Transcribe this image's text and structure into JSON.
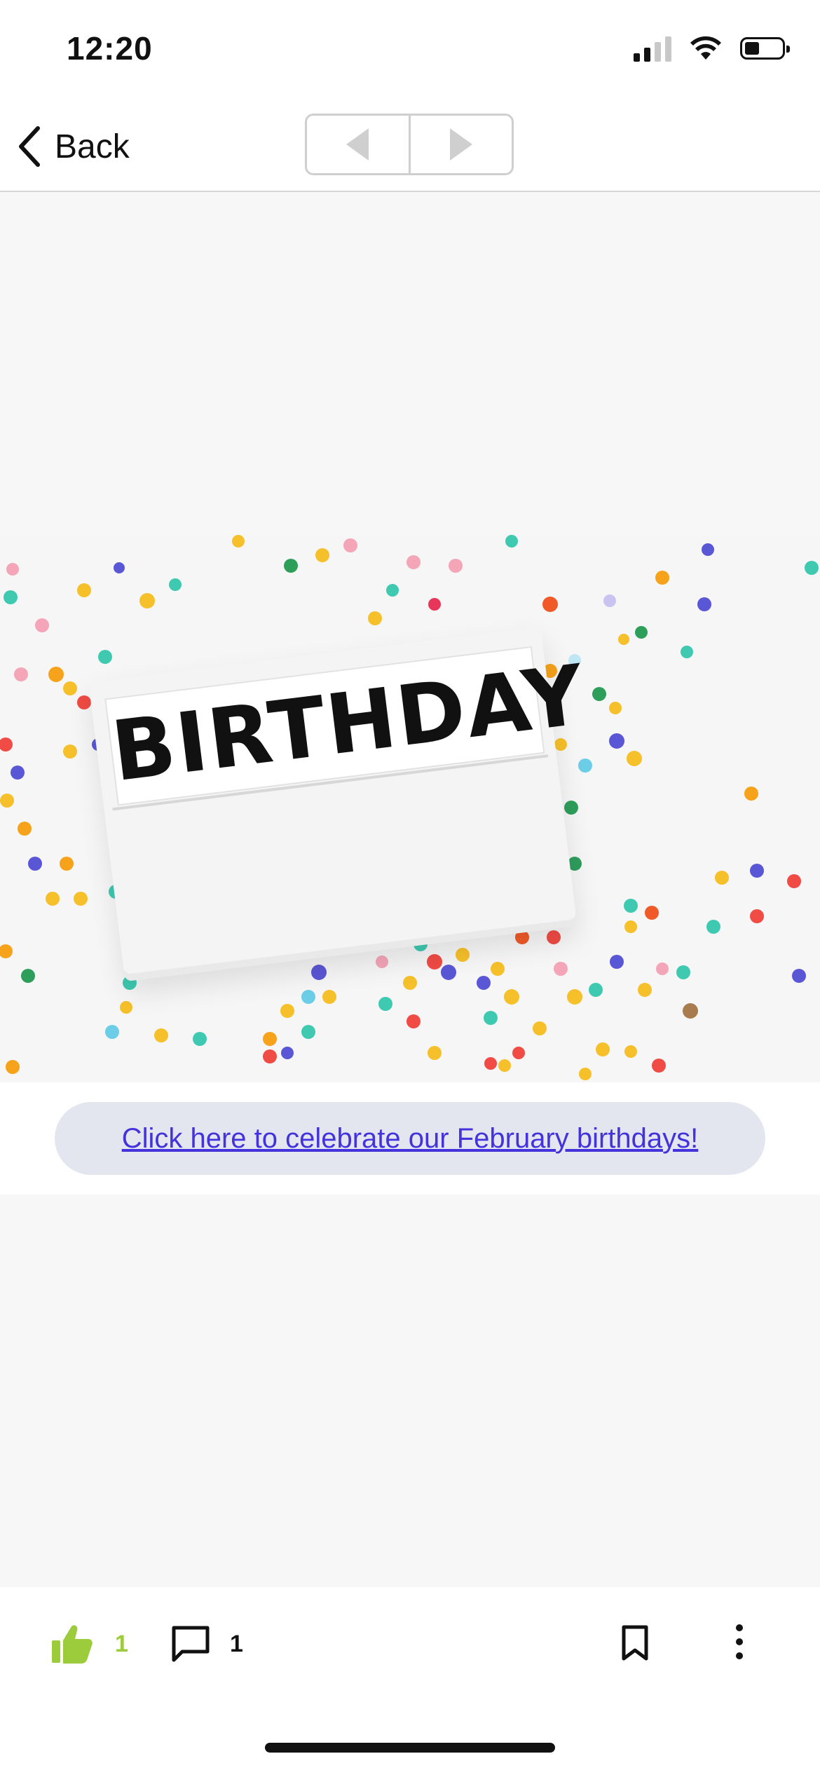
{
  "status_bar": {
    "time": "12:20",
    "battery_level": 0.35
  },
  "nav": {
    "back_label": "Back",
    "prev_icon": "triangle-left-icon",
    "next_icon": "triangle-right-icon"
  },
  "hero": {
    "sign_text": "BIRTHDAY"
  },
  "link": {
    "text": "Click here to celebrate our February birthdays!"
  },
  "toolbar": {
    "like_count": "1",
    "comment_count": "1",
    "like_color": "#9ccb3b",
    "icons": [
      "thumbs-up-icon",
      "comment-icon",
      "bookmark-icon",
      "more-vertical-icon"
    ]
  },
  "colors": {
    "link": "#4433dd",
    "pill_bg": "#e3e6ef"
  }
}
